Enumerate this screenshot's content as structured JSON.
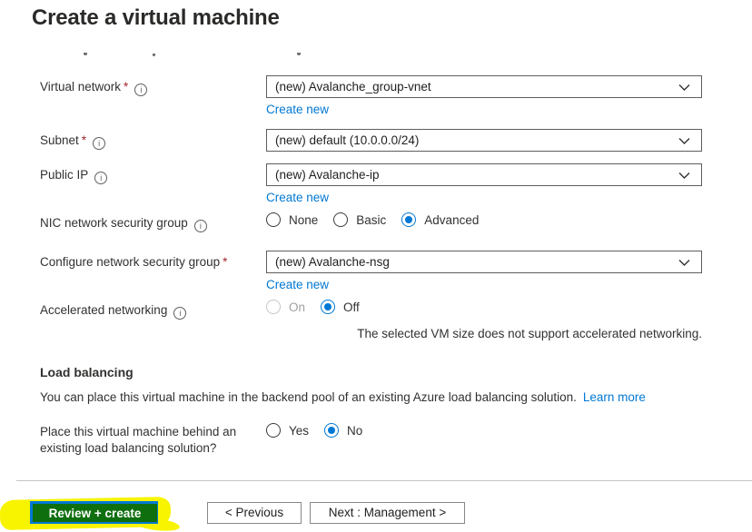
{
  "page": {
    "title": "Create a virtual machine"
  },
  "icons": {
    "info": "i"
  },
  "symbols": {
    "required": "*"
  },
  "form": {
    "fields": [
      {
        "label": "Virtual network",
        "required": "*",
        "value": "(new) Avalanche_group-vnet",
        "create_new": "Create new"
      },
      {
        "label": "Subnet",
        "required": "*",
        "value": "(new) default (10.0.0.0/24)"
      },
      {
        "label": "Public IP",
        "value": "(new) Avalanche-ip",
        "create_new": "Create new"
      },
      {
        "label": "NIC network security group",
        "options": [
          {
            "label": "None"
          },
          {
            "label": "Basic"
          },
          {
            "label": "Advanced",
            "selected": true
          }
        ]
      },
      {
        "label": "Configure network security group",
        "required": "*",
        "value": "(new) Avalanche-nsg",
        "create_new": "Create new"
      },
      {
        "label": "Accelerated networking",
        "options": [
          {
            "label": "On",
            "disabled": true
          },
          {
            "label": "Off",
            "selected": true
          }
        ],
        "note": "The selected VM size does not support accelerated networking."
      }
    ]
  },
  "load_balancing": {
    "heading": "Load balancing",
    "description": "You can place this virtual machine in the backend pool of an existing Azure load balancing solution.",
    "learn_more_label": "Learn more",
    "question": "Place this virtual machine behind an existing load balancing solution?",
    "options": [
      {
        "label": "Yes"
      },
      {
        "label": "No",
        "selected": true
      }
    ]
  },
  "footer": {
    "review_create_label": "Review + create",
    "previous_label": "< Previous",
    "next_label": "Next : Management >"
  },
  "colors": {
    "accent": "#0078d4",
    "link": "#0078d4",
    "required_marker": "#a4262c",
    "highlight_yellow": "#f8f400",
    "annotation_green": "#0f6f0f",
    "button_border": "#8a8886",
    "field_border": "#605e5c"
  }
}
